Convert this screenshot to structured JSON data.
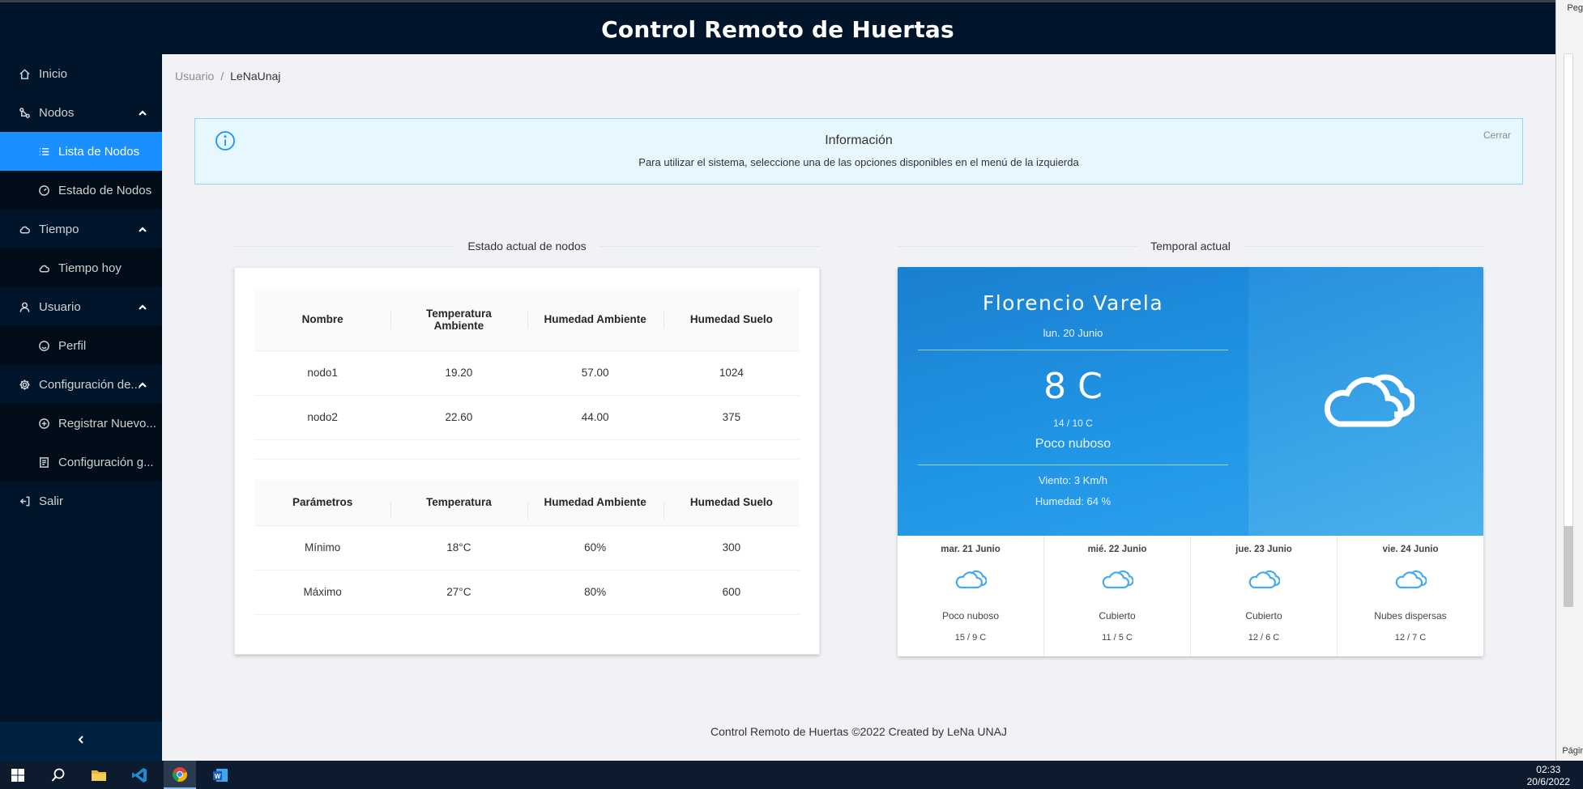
{
  "header": {
    "title": "Control Remoto de Huertas"
  },
  "sidebar": {
    "items": [
      {
        "label": "Inicio",
        "icon": "home-icon"
      },
      {
        "label": "Nodos",
        "icon": "nodes-icon"
      },
      {
        "label": "Lista de Nodos",
        "icon": "list-icon"
      },
      {
        "label": "Estado de Nodos",
        "icon": "dashboard-icon"
      },
      {
        "label": "Tiempo",
        "icon": "cloud-icon"
      },
      {
        "label": "Tiempo hoy",
        "icon": "cloud-icon"
      },
      {
        "label": "Usuario",
        "icon": "user-icon"
      },
      {
        "label": "Perfil",
        "icon": "smile-icon"
      },
      {
        "label": "Configuración de...",
        "icon": "gear-icon"
      },
      {
        "label": "Registrar Nuevo...",
        "icon": "plus-circle-icon"
      },
      {
        "label": "Configuración g...",
        "icon": "config-icon"
      },
      {
        "label": "Salir",
        "icon": "logout-icon"
      }
    ],
    "active_item": "Lista de Nodos",
    "accent_color": "#1890ff",
    "background_color": "#001529"
  },
  "breadcrumb": {
    "items": [
      "Usuario",
      "LeNaUnaj"
    ],
    "separator": "/"
  },
  "alert": {
    "title": "Información",
    "description": "Para utilizar el sistema, seleccione una de las opciones disponibles en el menú de la izquierda",
    "close": "Cerrar",
    "icon": "info-circle-icon"
  },
  "nodes_section": {
    "title": "Estado actual de nodos",
    "status_table": {
      "headers": [
        "Nombre",
        "Temperatura Ambiente",
        "Humedad Ambiente",
        "Humedad Suelo"
      ],
      "rows": [
        [
          "nodo1",
          "19.20",
          "57.00",
          "1024"
        ],
        [
          "nodo2",
          "22.60",
          "44.00",
          "375"
        ]
      ]
    },
    "params_table": {
      "headers": [
        "Parámetros",
        "Temperatura",
        "Humedad Ambiente",
        "Humedad Suelo"
      ],
      "rows": [
        [
          "Mínimo",
          "18°C",
          "60%",
          "300"
        ],
        [
          "Máximo",
          "27°C",
          "80%",
          "600"
        ]
      ]
    }
  },
  "weather_section": {
    "title": "Temporal actual",
    "city": "Florencio Varela",
    "date": "lun. 20 Junio",
    "temperature": "8 C",
    "min_max": "14 / 10 C",
    "description": "Poco nuboso",
    "wind": "Viento: 3 Km/h",
    "humidity": "Humedad: 64 %",
    "icon": "clouds-icon",
    "forecast": [
      {
        "day": "mar. 21 Junio",
        "desc": "Poco nuboso",
        "temps": "15 / 9 C"
      },
      {
        "day": "mié. 22 Junio",
        "desc": "Cubierto",
        "temps": "11 / 5 C"
      },
      {
        "day": "jue. 23 Junio",
        "desc": "Cubierto",
        "temps": "12 / 6 C"
      },
      {
        "day": "vie. 24 Junio",
        "desc": "Nubes dispersas",
        "temps": "12 / 7 C"
      }
    ]
  },
  "footer": {
    "text": "Control Remoto de Huertas ©2022 Created by LeNa UNAJ"
  },
  "word_panel": {
    "top_label": "Peg",
    "bottom_label": "Págir"
  },
  "taskbar": {
    "apps": [
      "windows-start-icon",
      "search-icon",
      "file-explorer-icon",
      "vscode-icon",
      "chrome-icon",
      "word-icon"
    ],
    "time": "02:33",
    "date": "20/6/2022"
  }
}
